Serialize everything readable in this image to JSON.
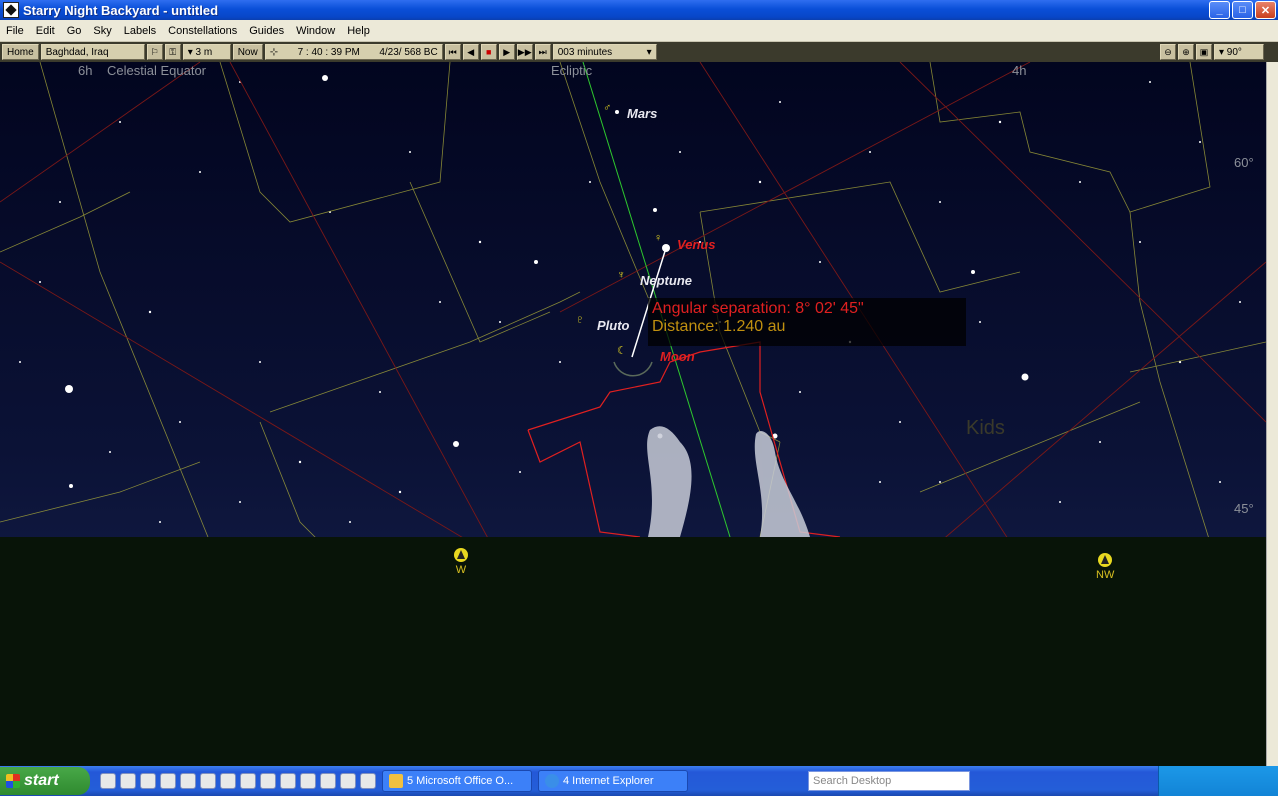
{
  "window": {
    "title": "Starry Night Backyard - untitled",
    "controls": {
      "minimize": "_",
      "maximize": "□",
      "close": "✕"
    }
  },
  "menubar": {
    "items": [
      "File",
      "Edit",
      "Go",
      "Sky",
      "Labels",
      "Constellations",
      "Guides",
      "Window",
      "Help"
    ]
  },
  "toolbar": {
    "home_label": "Home",
    "location": "Baghdad, Iraq",
    "elevation": "▾ 3 m",
    "now_label": "Now",
    "time": "7 : 40 : 39 PM",
    "date": "4/23/  568 BC",
    "time_step": "003 minutes",
    "fov": "▾ 90°"
  },
  "sky": {
    "grid_labels": {
      "ra_6h": "6h",
      "celestial_equator": "Celestial Equator",
      "ecliptic": "Ecliptic",
      "ra_4h": "4h",
      "dec_60": "60°",
      "dec_45": "45°"
    },
    "planets": {
      "mars": {
        "label": "Mars",
        "symbol": "♂"
      },
      "venus": {
        "label": "Venus",
        "symbol": "♀"
      },
      "neptune": {
        "label": "Neptune",
        "symbol": "♆"
      },
      "pluto": {
        "label": "Pluto",
        "symbol": "♇"
      },
      "moon": {
        "label": "Moon",
        "symbol": "☾"
      }
    },
    "constellation_label": "Kids",
    "info": {
      "angular_separation": "Angular separation: 8° 02' 45\"",
      "distance": "Distance: 1.240 au"
    },
    "compass": {
      "west": "W",
      "northwest": "NW"
    },
    "colors": {
      "sky_top": "#02051f",
      "ground": "#081408",
      "highlight_red": "#e02020",
      "distance_gold": "#c09010"
    }
  },
  "taskbar": {
    "start_label": "start",
    "tasks": [
      {
        "label": "5 Microsoft Office O...",
        "icon": "office-icon"
      },
      {
        "label": "4 Internet Explorer",
        "icon": "ie-icon"
      }
    ],
    "search_placeholder": "Search Desktop"
  }
}
